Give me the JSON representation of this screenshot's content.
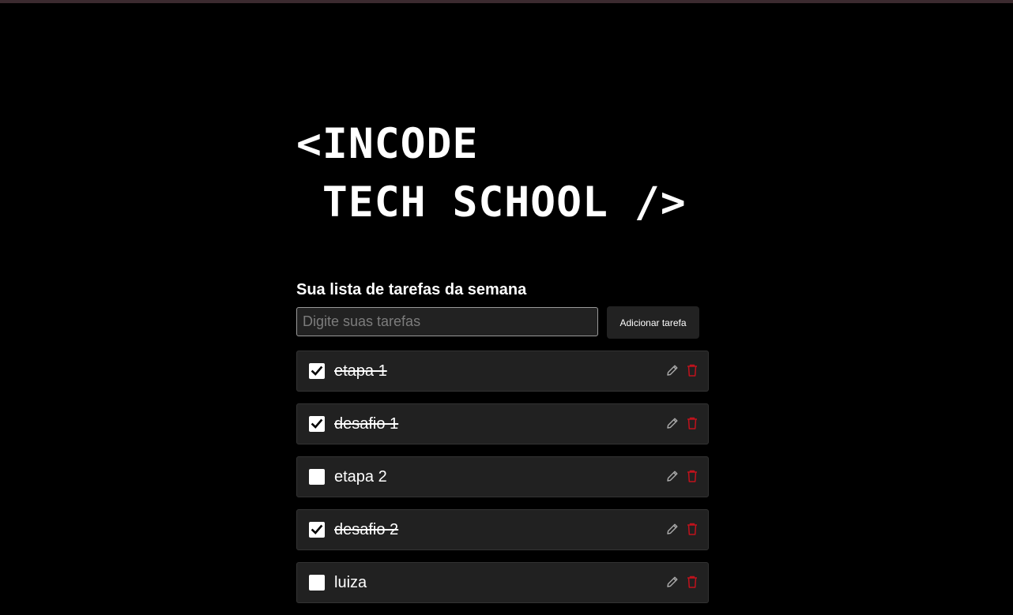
{
  "logo": {
    "line1": "<INCODE",
    "line2": " TECH SCHOOL />"
  },
  "heading": "Sua lista de tarefas da semana",
  "input": {
    "placeholder": "Digite suas tarefas",
    "value": ""
  },
  "add_button_label": "Adicionar tarefa",
  "tasks": [
    {
      "label": "etapa 1",
      "done": true
    },
    {
      "label": "desafio 1",
      "done": true
    },
    {
      "label": "etapa 2",
      "done": false
    },
    {
      "label": "desafio 2",
      "done": true
    },
    {
      "label": "luiza",
      "done": false
    }
  ],
  "icons": {
    "check": "check-icon",
    "edit": "pencil-icon",
    "delete": "trash-icon"
  },
  "colors": {
    "background": "#000000",
    "card": "#212121",
    "delete": "#c0121c",
    "edit": "#aaaaaa"
  }
}
